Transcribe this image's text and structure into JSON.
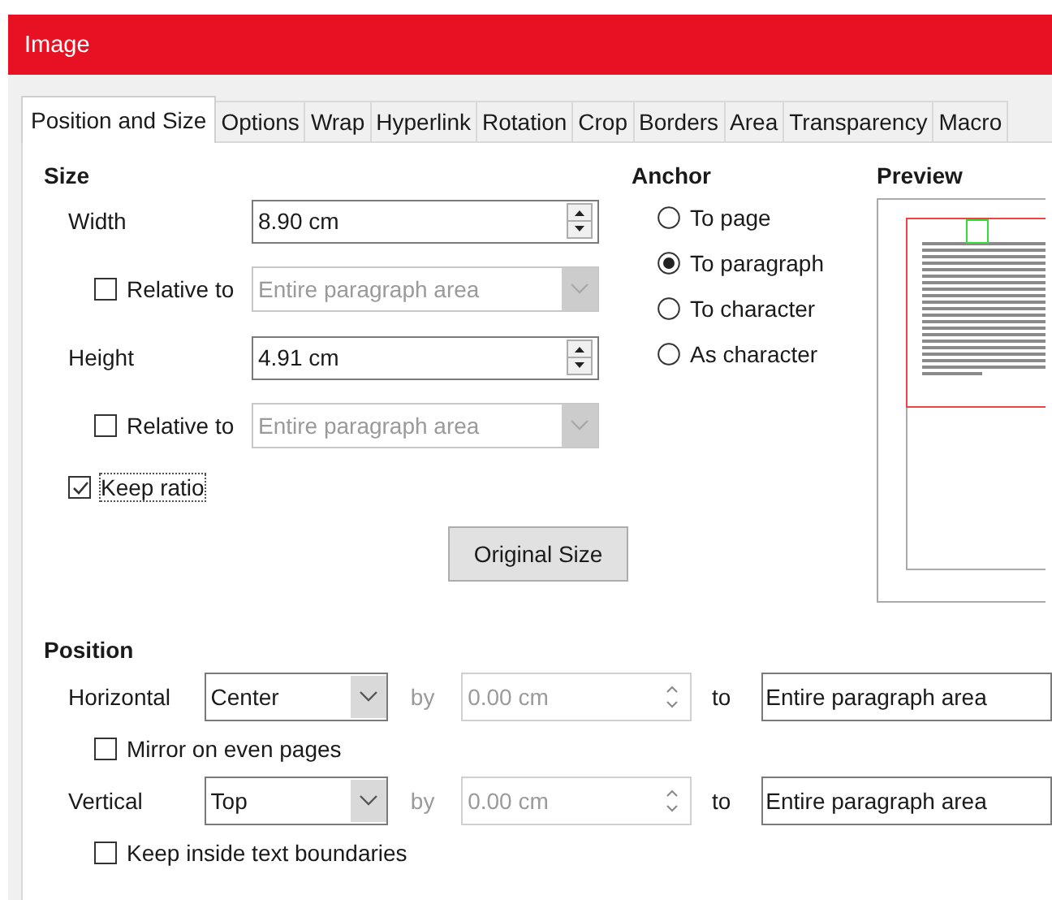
{
  "window": {
    "title": "Image"
  },
  "tabs": [
    {
      "label": "Position and Size",
      "selected": true
    },
    {
      "label": "Options",
      "selected": false
    },
    {
      "label": "Wrap",
      "selected": false
    },
    {
      "label": "Hyperlink",
      "selected": false
    },
    {
      "label": "Rotation",
      "selected": false
    },
    {
      "label": "Crop",
      "selected": false
    },
    {
      "label": "Borders",
      "selected": false
    },
    {
      "label": "Area",
      "selected": false
    },
    {
      "label": "Transparency",
      "selected": false
    },
    {
      "label": "Macro",
      "selected": false
    }
  ],
  "size": {
    "heading": "Size",
    "rows": [
      {
        "kind": "spin",
        "label": "Width",
        "value": "8.90 cm"
      },
      {
        "kind": "relative",
        "label": "Relative to",
        "checked": false,
        "value": "Entire paragraph area",
        "disabled": true
      },
      {
        "kind": "spin",
        "label": "Height",
        "value": "4.91 cm"
      },
      {
        "kind": "relative",
        "label": "Relative to",
        "checked": false,
        "value": "Entire paragraph area",
        "disabled": true
      },
      {
        "kind": "check",
        "label": "Keep ratio",
        "checked": true
      }
    ],
    "button": "Original Size"
  },
  "anchor": {
    "heading": "Anchor",
    "options": [
      {
        "label": "To page",
        "selected": false
      },
      {
        "label": "To paragraph",
        "selected": true
      },
      {
        "label": "To character",
        "selected": false
      },
      {
        "label": "As character",
        "selected": false
      }
    ]
  },
  "preview": {
    "heading": "Preview"
  },
  "position": {
    "heading": "Position",
    "rows": [
      {
        "label": "Horizontal",
        "value": "Center",
        "by_label": "by",
        "by_value": "0.00 cm",
        "by_disabled": true,
        "to_label": "to",
        "to_value": "Entire paragraph area",
        "option": {
          "label": "Mirror on even pages",
          "checked": false
        }
      },
      {
        "label": "Vertical",
        "value": "Top",
        "by_label": "by",
        "by_value": "0.00 cm",
        "by_disabled": true,
        "to_label": "to",
        "to_value": "Entire paragraph area",
        "option": {
          "label": "Keep inside text boundaries",
          "checked": false
        }
      }
    ]
  }
}
